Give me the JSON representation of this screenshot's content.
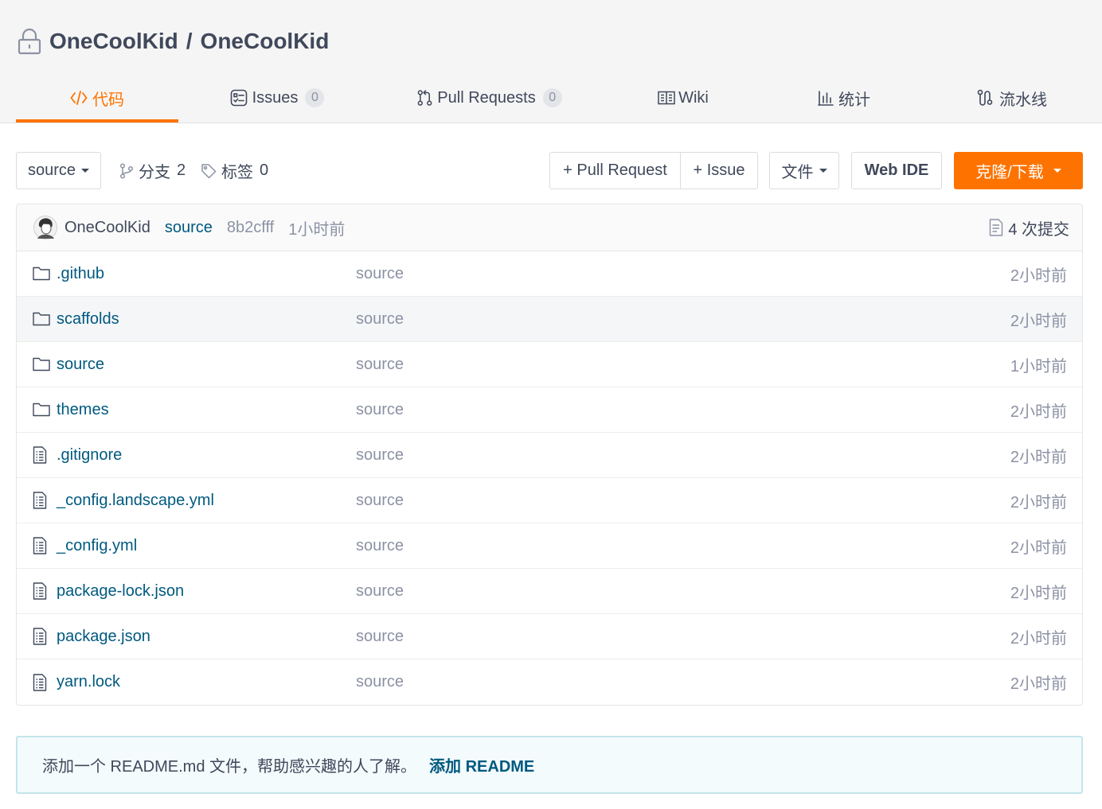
{
  "colors": {
    "accent": "#fe7300",
    "link": "#005980",
    "text": "#40485b",
    "muted": "#8c92a4"
  },
  "repo": {
    "owner": "OneCoolKid",
    "separator": "/",
    "name": "OneCoolKid",
    "visibility_icon": "lock-icon"
  },
  "tabs": [
    {
      "label": "代码",
      "icon": "code-icon",
      "active": true
    },
    {
      "label": "Issues",
      "count": "0",
      "icon": "issues-icon"
    },
    {
      "label": "Pull Requests",
      "count": "0",
      "icon": "pull-request-icon"
    },
    {
      "label": "Wiki",
      "icon": "wiki-icon"
    },
    {
      "label": "统计",
      "icon": "stats-icon"
    },
    {
      "label": "流水线",
      "icon": "pipeline-icon"
    }
  ],
  "toolbar": {
    "branch_select": {
      "value": "source",
      "icon": "caret-down-icon"
    },
    "branches": {
      "label": "分支",
      "count": "2",
      "icon": "branch-icon"
    },
    "tags": {
      "label": "标签",
      "count": "0",
      "icon": "tag-icon"
    },
    "new_pull_request": "+ Pull Request",
    "new_issue": "+ Issue",
    "file_menu": "文件",
    "web_ide": "Web IDE",
    "clone_download": "克隆/下载"
  },
  "latest_commit": {
    "author": "OneCoolKid",
    "branch": "source",
    "hash": "8b2cfff",
    "time": "1小时前",
    "commits_label": "4 次提交",
    "commits_icon": "commits-icon"
  },
  "files": [
    {
      "name": ".github",
      "icon": "folder-icon",
      "message": "source",
      "time": "2小时前"
    },
    {
      "name": "scaffolds",
      "icon": "folder-icon",
      "message": "source",
      "time": "2小时前"
    },
    {
      "name": "source",
      "icon": "folder-icon",
      "message": "source",
      "time": "1小时前"
    },
    {
      "name": "themes",
      "icon": "folder-icon",
      "message": "source",
      "time": "2小时前"
    },
    {
      "name": ".gitignore",
      "icon": "file-icon",
      "message": "source",
      "time": "2小时前"
    },
    {
      "name": "_config.landscape.yml",
      "icon": "file-icon",
      "message": "source",
      "time": "2小时前"
    },
    {
      "name": "_config.yml",
      "icon": "file-icon",
      "message": "source",
      "time": "2小时前"
    },
    {
      "name": "package-lock.json",
      "icon": "file-icon",
      "message": "source",
      "time": "2小时前"
    },
    {
      "name": "package.json",
      "icon": "file-icon",
      "message": "source",
      "time": "2小时前"
    },
    {
      "name": "yarn.lock",
      "icon": "file-icon",
      "message": "source",
      "time": "2小时前"
    }
  ],
  "readme_notice": {
    "text": "添加一个 README.md 文件，帮助感兴趣的人了解。",
    "link": "添加 README"
  }
}
